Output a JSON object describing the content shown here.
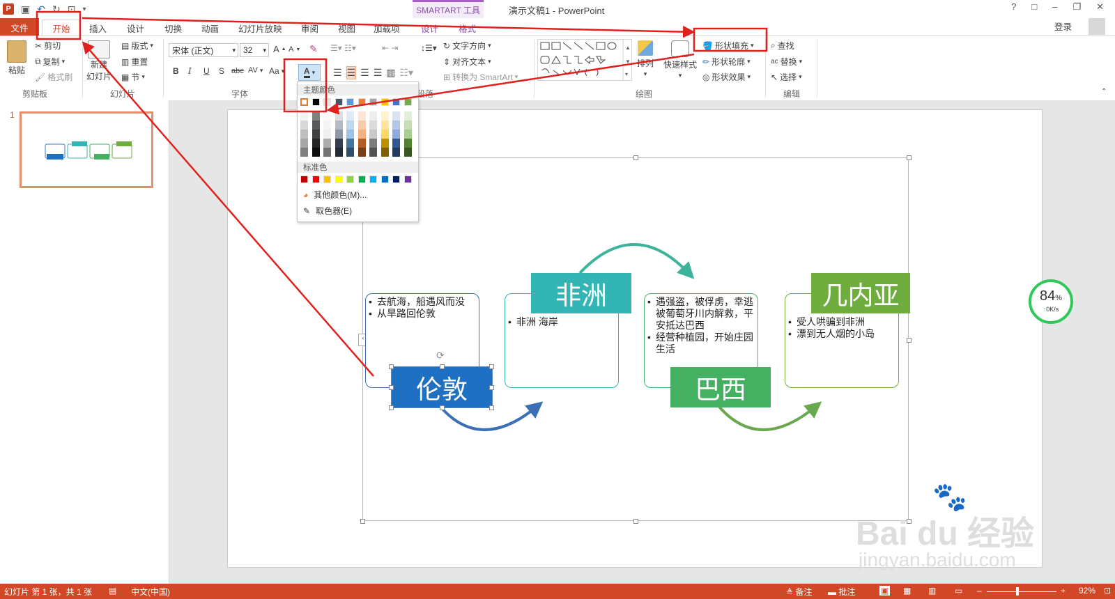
{
  "title_bar": {
    "app_icon": "P",
    "smartart_tools": "SMARTART 工具",
    "window_title": "演示文稿1 - PowerPoint",
    "help": "?",
    "restore_ribbon": "□",
    "minimize": "–",
    "maximize": "❐",
    "close": "✕"
  },
  "tabs": {
    "file": "文件",
    "items": [
      "开始",
      "插入",
      "设计",
      "切换",
      "动画",
      "幻灯片放映",
      "审阅",
      "视图",
      "加载项",
      "设计",
      "格式"
    ],
    "login": "登录"
  },
  "ribbon": {
    "clipboard": {
      "paste": "粘贴",
      "cut": "剪切",
      "copy": "复制",
      "format_painter": "格式刷",
      "label": "剪贴板"
    },
    "slides": {
      "new_slide_1": "新建",
      "new_slide_2": "幻灯片",
      "layout": "版式",
      "reset": "重置",
      "section": "节",
      "label": "幻灯片"
    },
    "font": {
      "font_name": "宋体 (正文)",
      "font_size": "32",
      "bold": "B",
      "italic": "I",
      "underline": "U",
      "shadow": "S",
      "strike": "abc",
      "spacing": "AV",
      "case": "Aa",
      "font_color": "A",
      "label": "字体"
    },
    "paragraph": {
      "text_direction": "文字方向",
      "align_text": "对齐文本",
      "convert_smartart": "转换为 SmartArt",
      "label": "段落"
    },
    "drawing": {
      "arrange": "排列",
      "quick_styles": "快速样式",
      "shape_fill": "形状填充",
      "shape_outline": "形状轮廓",
      "shape_effects": "形状效果",
      "label": "绘图"
    },
    "editing": {
      "find": "查找",
      "replace": "替换",
      "select": "选择",
      "label": "编辑"
    }
  },
  "thumbnails": {
    "slide_number": "1"
  },
  "color_popup": {
    "theme_label": "主题颜色",
    "standard_label": "标准色",
    "more_colors": "其他颜色(M)...",
    "eyedropper": "取色器(E)",
    "theme_top": [
      "#ffffff",
      "#000000",
      "#e7e6e6",
      "#44546a",
      "#5b9bd5",
      "#ed7d31",
      "#a5a5a5",
      "#ffc000",
      "#4472c4",
      "#70ad47"
    ],
    "standard": [
      "#c00000",
      "#ff0000",
      "#ffc000",
      "#ffff00",
      "#92d050",
      "#00b050",
      "#00b0f0",
      "#0070c0",
      "#002060",
      "#7030a0"
    ]
  },
  "smartart": {
    "nodes": [
      {
        "title": "伦敦",
        "color": "#1f6fc2",
        "bullets": [
          "去航海，船遇风而没",
          "从旱路回伦敦"
        ]
      },
      {
        "title": "非洲",
        "color": "#34b5b5",
        "bullets": [
          "非洲 海岸"
        ]
      },
      {
        "title": "巴西",
        "color": "#43b161",
        "bullets": [
          "遇强盗，被俘虏，幸逃被葡萄牙川内解救，平安抵达巴西",
          "经营种植园，开始庄园生活"
        ]
      },
      {
        "title": "几内亚",
        "color": "#6fad3f",
        "bullets": [
          "受人哄骗到非洲",
          "漂到无人烟的小岛"
        ]
      }
    ]
  },
  "status_bar": {
    "slide_info": "幻灯片 第 1 张，共 1 张",
    "language": "中文(中国)",
    "notes": "备注",
    "comments": "批注",
    "zoom": "92%"
  },
  "speed_widget": {
    "percent": "84",
    "unit": "%",
    "rate": "0K/s"
  },
  "watermark": {
    "brand": "Bai du 经验",
    "url": "jingyan.baidu.com"
  }
}
